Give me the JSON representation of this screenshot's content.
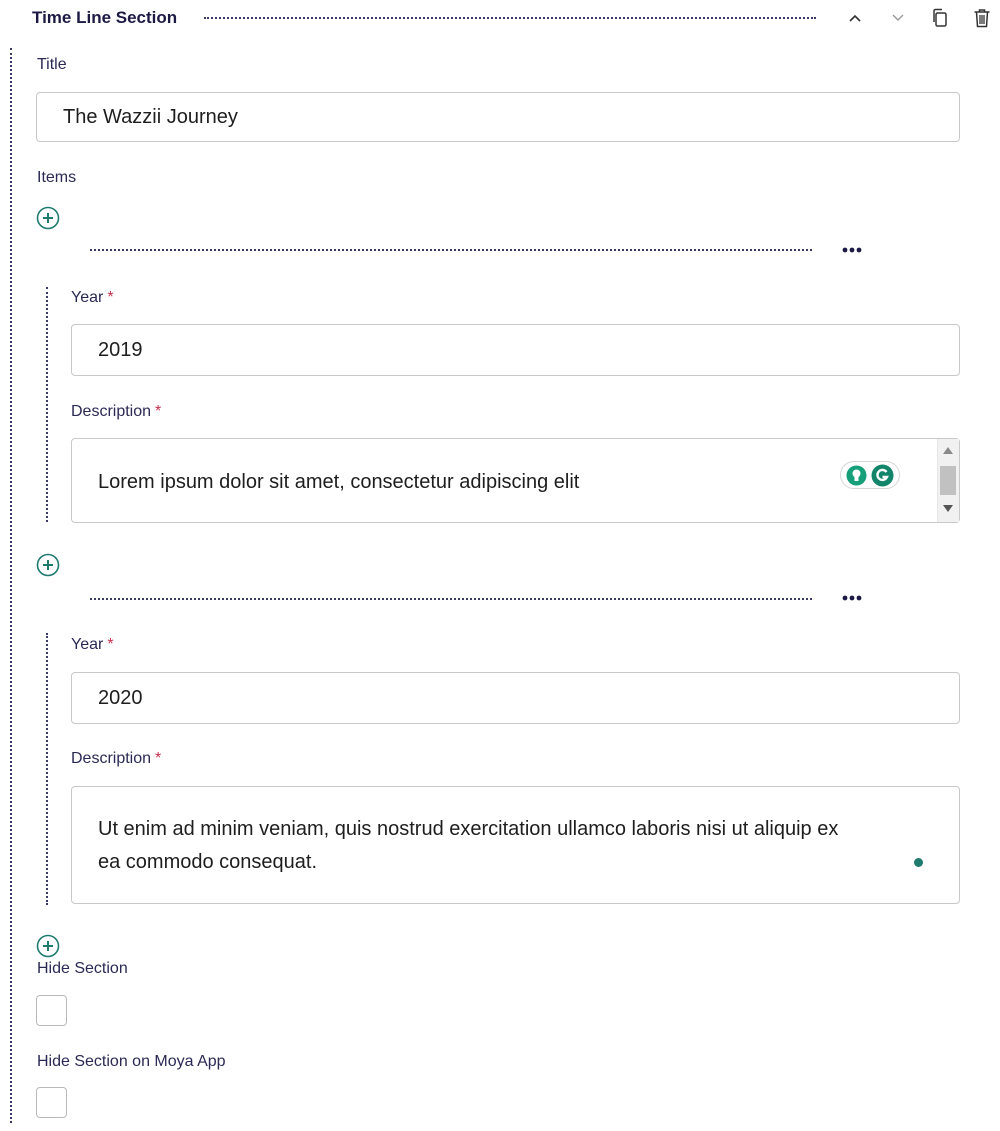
{
  "section": {
    "title": "Time Line Section"
  },
  "title_field": {
    "label": "Title",
    "value": "The Wazzii Journey"
  },
  "items": {
    "label": "Items",
    "list": [
      {
        "year_label": "Year",
        "year_required": "*",
        "year_value": "2019",
        "description_label": "Description",
        "description_required": "*",
        "description_value": "Lorem ipsum dolor sit amet, consectetur adipiscing elit"
      },
      {
        "year_label": "Year",
        "year_required": "*",
        "year_value": "2020",
        "description_label": "Description",
        "description_required": "*",
        "description_value_line1": "Ut enim ad minim veniam, quis nostrud exercitation ullamco laboris nisi ut aliquip ex",
        "description_value_line2": "ea commodo consequat."
      }
    ]
  },
  "hide_section": {
    "label": "Hide Section",
    "checked": false
  },
  "hide_section_moya": {
    "label": "Hide Section on Moya App",
    "checked": false
  },
  "icons": {
    "move_up": "chevron-up-icon",
    "move_down": "chevron-down-icon",
    "duplicate": "copy-icon",
    "delete": "trash-icon",
    "add": "plus-circle-icon",
    "more": "more-horizontal-icon",
    "grammarly": "grammarly-icon",
    "suggestion": "lightbulb-icon"
  },
  "colors": {
    "accent": "#1f7a6e",
    "heading": "#1c1a45",
    "required": "#c4314b"
  }
}
